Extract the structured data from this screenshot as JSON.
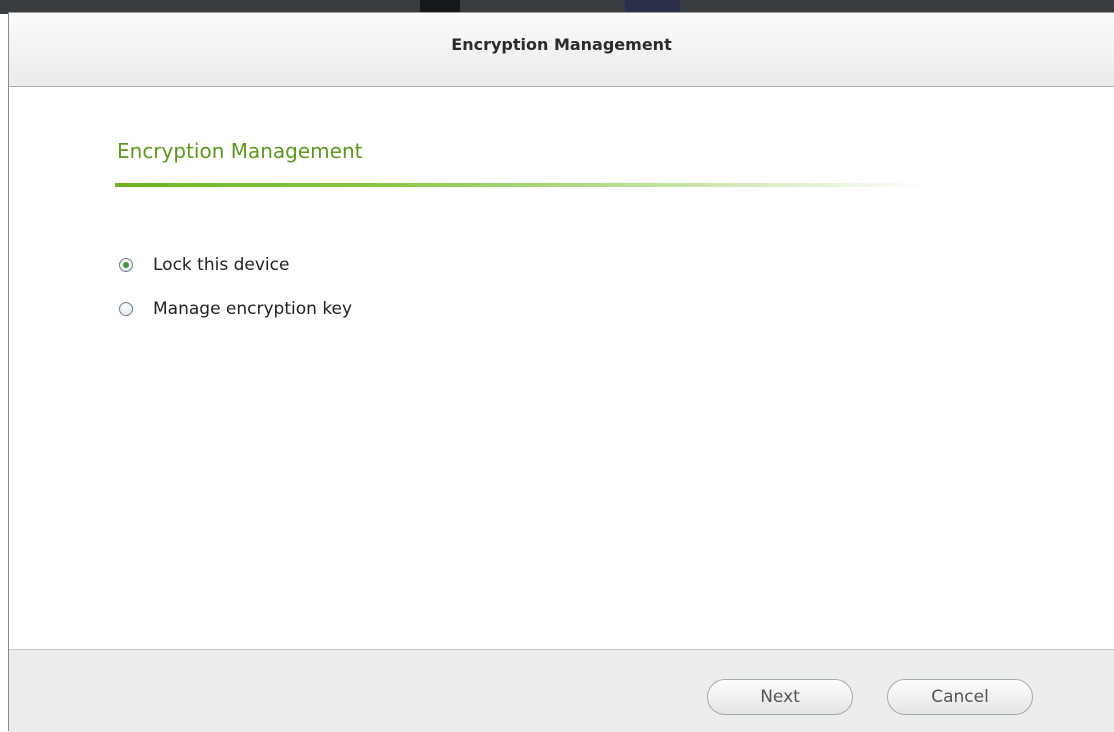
{
  "window": {
    "title": "Encryption Management"
  },
  "main": {
    "section_title": "Encryption Management",
    "options": [
      {
        "label": "Lock this device",
        "selected": true
      },
      {
        "label": "Manage encryption key",
        "selected": false
      }
    ]
  },
  "footer": {
    "next_label": "Next",
    "cancel_label": "Cancel"
  },
  "colors": {
    "accent_green": "#5a9a18",
    "radio_dot": "#3d9a2a",
    "footer_bg": "#eceded"
  },
  "icons": {
    "radio_selected": "radio-checked-icon",
    "radio_unselected": "radio-unchecked-icon"
  }
}
